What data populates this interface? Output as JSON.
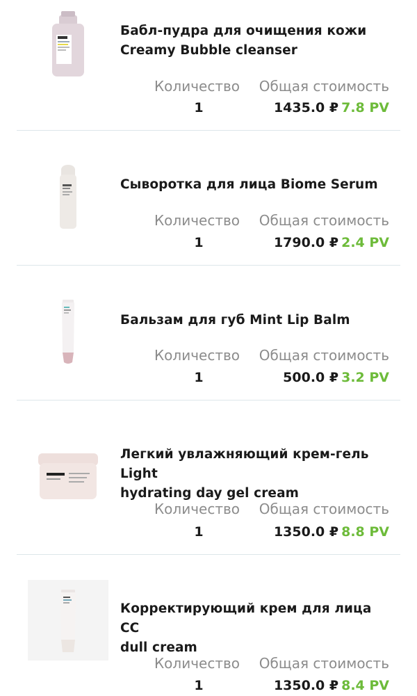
{
  "labels": {
    "quantity": "Количество",
    "total": "Общая стоимость"
  },
  "colors": {
    "pv": "#6dbb3a",
    "label": "#8c8c8c",
    "divider": "#dde6ea"
  },
  "items": [
    {
      "image": "bubble-cleanser-bottle",
      "brand_on_pack": "BE LOVED",
      "title_line1": "Бабл-пудра для очищения кожи",
      "title_line2": "Creamy Bubble cleanser",
      "quantity": "1",
      "price": "1435.0 ₽",
      "pv": "7.8 PV"
    },
    {
      "image": "serum-bottle",
      "title_line1": "Сыворотка для лица Biome Serum",
      "title_line2": "",
      "quantity": "1",
      "price": "1790.0 ₽",
      "pv": "2.4 PV"
    },
    {
      "image": "lip-balm-tube",
      "title_line1": "Бальзам для губ Mint Lip Balm",
      "title_line2": "",
      "quantity": "1",
      "price": "500.0 ₽",
      "pv": "3.2 PV"
    },
    {
      "image": "cream-jar",
      "brand_on_pack": "BE LOVED",
      "title_line1": "Легкий увлажняющий крем-гель Light",
      "title_line2": "hydrating day gel cream",
      "quantity": "1",
      "price": "1350.0 ₽",
      "pv": "8.8 PV"
    },
    {
      "image": "cc-cream-tube",
      "title_line1": "Корректирующий крем для лица CC",
      "title_line2": "dull cream",
      "quantity": "1",
      "price": "1350.0 ₽",
      "pv": "8.4 PV"
    }
  ]
}
